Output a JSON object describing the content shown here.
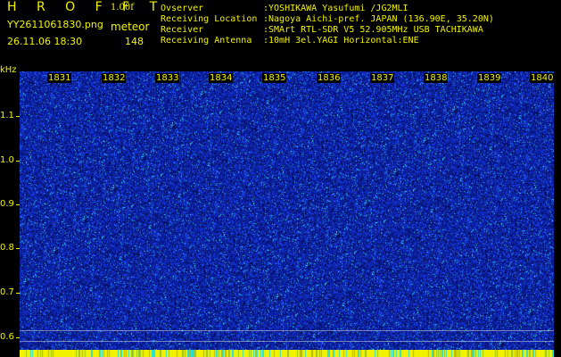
{
  "header": {
    "app_title": "H R O F F T",
    "version": "1.00f",
    "filename": "YY2611061830.png",
    "mode": "meteor",
    "datetime": "26.11.06 18:30",
    "count": "148"
  },
  "info": [
    {
      "label": "Ovserver",
      "value": ":YOSHIKAWA Yasufumi /JG2MLI"
    },
    {
      "label": "Receiving Location",
      "value": ":Nagoya Aichi-pref. JAPAN (136.90E, 35.20N)"
    },
    {
      "label": "Receiver",
      "value": ":SMArt RTL-SDR V5 52.905MHz USB TACHIKAWA"
    },
    {
      "label": "Receiving Antenna",
      "value": ":10mH 3el.YAGI Horizontal:ENE"
    }
  ],
  "axis": {
    "unit": "kHz",
    "y_labels": [
      "1.1",
      "1.0",
      "0.9",
      "0.8",
      "0.7",
      "0.6"
    ],
    "minute_labels": [
      "1831",
      "1832",
      "1833",
      "1834",
      "1835",
      "1836",
      "1837",
      "1838",
      "1839",
      "1840"
    ]
  },
  "colors": {
    "background": "#000000",
    "text": "#f2f200",
    "waterfall_base": "#0a1f8f",
    "signal_low": "#1e3cff",
    "signal_high": "#2ee6e6",
    "meter": "#f2f200"
  }
}
